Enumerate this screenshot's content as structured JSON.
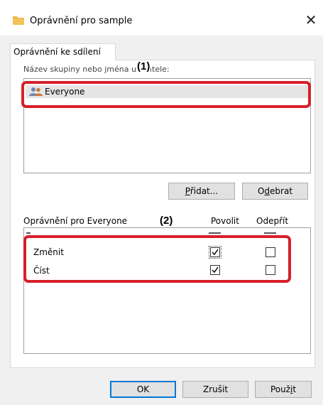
{
  "window": {
    "title": "Oprávnění pro sample",
    "close_icon": "close-icon"
  },
  "tabs": [
    {
      "label": "Oprávnění ke sdílení",
      "active": true
    }
  ],
  "groups": {
    "label_partial": "Název skupiny nebo jména uživatele:",
    "items": [
      {
        "name": "Everyone",
        "icon": "users-icon",
        "selected": true
      }
    ]
  },
  "group_buttons": {
    "add": {
      "text": "řidat...",
      "mnemonic": "P"
    },
    "remove": {
      "pre": "O",
      "mnemonic": "d",
      "post": "ebrat"
    }
  },
  "permissions": {
    "header": "Oprávnění pro Everyone",
    "allow_column": "Povolit",
    "deny_column": "Odepřít",
    "rows": [
      {
        "name": "Změnit",
        "allow": true,
        "deny": false
      },
      {
        "name": "Číst",
        "allow": true,
        "deny": false
      }
    ]
  },
  "footer_buttons": {
    "ok": "OK",
    "cancel": "Zrušit",
    "apply": {
      "pre": "Použ",
      "mnemonic": "i",
      "post": "t"
    }
  },
  "annotations": {
    "callout_1": "(1)",
    "callout_2": "(2)",
    "color": "#d6202b"
  },
  "colors": {
    "accent": "#0078d7",
    "selection": "#e5e5e5",
    "folder": "#e8b84a"
  }
}
